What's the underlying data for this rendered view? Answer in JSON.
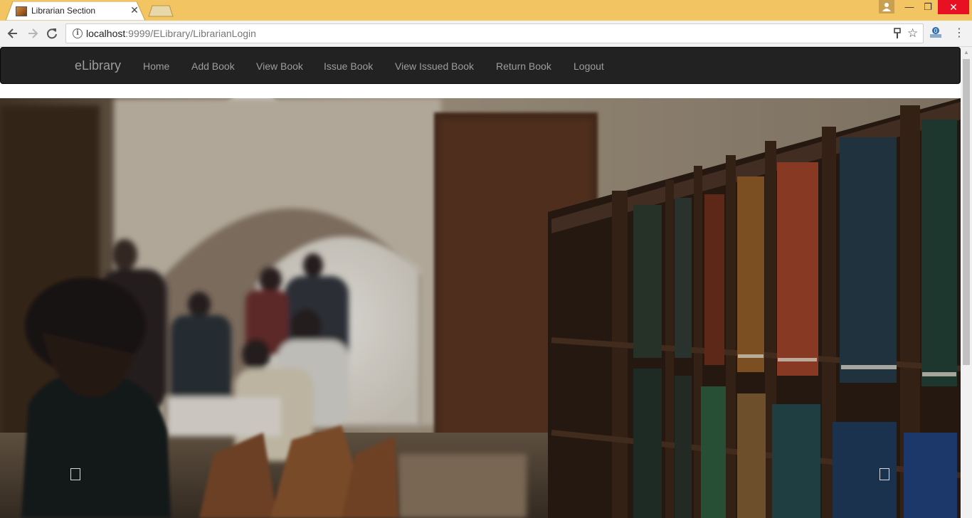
{
  "browser": {
    "tab_title": "Librarian Section",
    "tab_close": "✕",
    "url_host": "localhost",
    "url_rest": ":9999/ELibrary/LibrarianLogin",
    "window_min": "—",
    "window_max": "❐",
    "window_close": "✕",
    "menu": "⋮"
  },
  "navbar": {
    "brand": "eLibrary",
    "links": [
      "Home",
      "Add Book",
      "View Book",
      "Issue Book",
      "View Issued Book",
      "Return Book",
      "Logout"
    ]
  },
  "carousel": {
    "image_description": "library reading room with bookshelves"
  },
  "colors": {
    "titlebar": "#f2c462",
    "navbar_bg": "#222222",
    "navbar_text": "#9d9d9d",
    "close_button": "#e81123"
  },
  "icons": [
    "back-arrow-icon",
    "forward-arrow-icon",
    "reload-icon",
    "info-icon",
    "key-icon",
    "star-icon",
    "user-icon",
    "kebab-menu-icon"
  ]
}
